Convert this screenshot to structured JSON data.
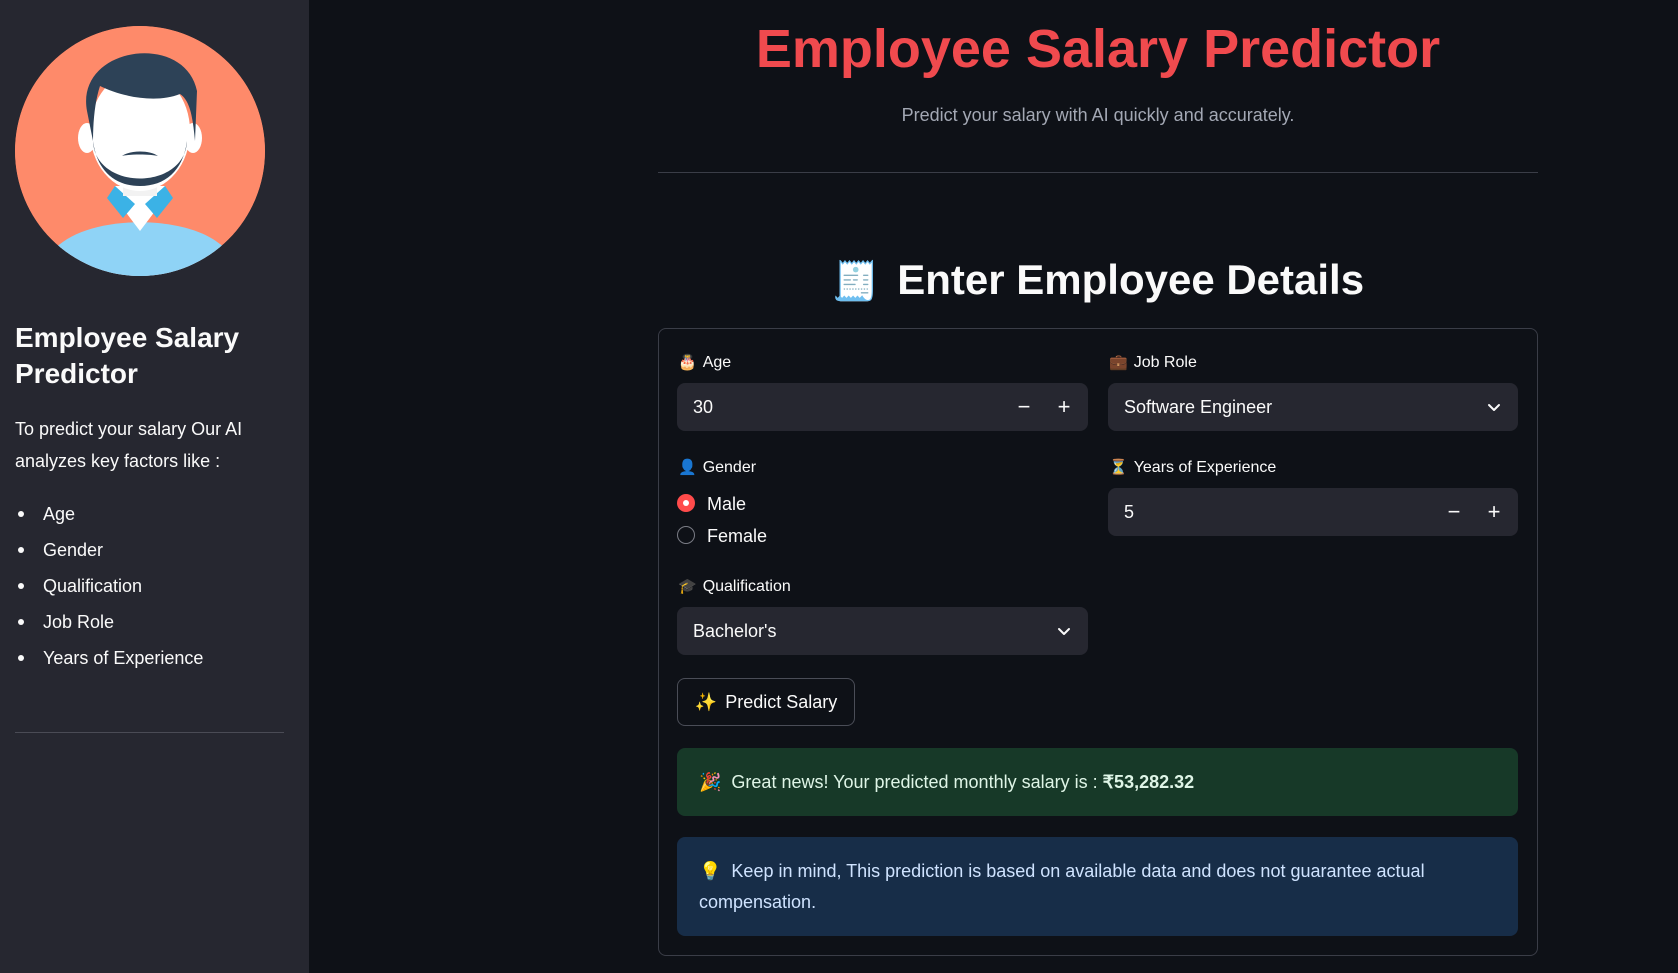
{
  "sidebar": {
    "title": "Employee Salary Predictor",
    "description": "To predict your salary Our AI analyzes key factors like :",
    "factors": [
      "Age",
      "Gender",
      "Qualification",
      "Job Role",
      "Years of Experience"
    ]
  },
  "header": {
    "title": "Employee Salary Predictor",
    "subtitle": "Predict your salary with AI quickly and accurately."
  },
  "section": {
    "emoji": "🧾",
    "title": "Enter Employee Details"
  },
  "form": {
    "age": {
      "icon": "🎂",
      "label": "Age",
      "value": "30",
      "minus": "−",
      "plus": "+"
    },
    "job_role": {
      "icon": "💼",
      "label": "Job Role",
      "value": "Software Engineer"
    },
    "gender": {
      "icon": "👤",
      "label": "Gender",
      "options": [
        "Male",
        "Female"
      ],
      "selected": "Male"
    },
    "experience": {
      "icon": "⏳",
      "label": "Years of Experience",
      "value": "5",
      "minus": "−",
      "plus": "+"
    },
    "qualification": {
      "icon": "🎓",
      "label": "Qualification",
      "value": "Bachelor's"
    },
    "predict_button": {
      "icon": "✨",
      "label": "Predict Salary"
    }
  },
  "result": {
    "icon": "🎉",
    "text": "Great news! Your predicted monthly salary is : ",
    "amount": "₹53,282.32"
  },
  "info": {
    "icon": "💡",
    "text": "Keep in mind, This prediction is based on available data and does not guarantee actual compensation."
  },
  "colors": {
    "accent": "#ff4b4b",
    "title_red": "#f04a4e",
    "sidebar_bg": "#262730",
    "main_bg": "#0e1117",
    "success_bg": "#173928",
    "info_bg": "#172d48"
  }
}
